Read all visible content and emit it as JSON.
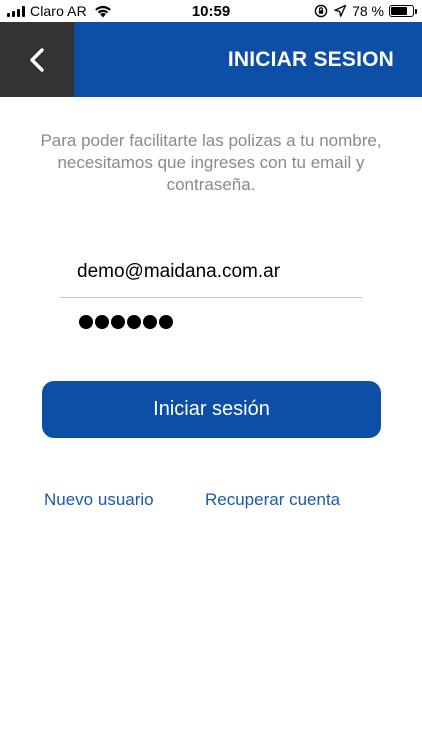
{
  "status_bar": {
    "carrier": "Claro AR",
    "time": "10:59",
    "battery_percent": "78 %",
    "battery_level": 0.78,
    "icons": [
      "signal-icon",
      "wifi-icon",
      "orientation-lock-icon",
      "location-arrow-icon",
      "battery-icon"
    ]
  },
  "header": {
    "title": "INICIAR SESION",
    "back_icon": "chevron-left-icon",
    "colors": {
      "header_bg": "#0d4ea6",
      "back_bg": "#333333"
    }
  },
  "intro": {
    "text": "Para poder facilitarte las polizas a tu nombre, necesitamos que ingreses con tu email y contraseña."
  },
  "form": {
    "email_value": "demo@maidana.com.ar",
    "password_masked": "●●●●●●",
    "password_length": 6
  },
  "actions": {
    "login_label": "Iniciar sesión",
    "new_user_label": "Nuevo usuario",
    "recover_label": "Recuperar cuenta",
    "colors": {
      "button_bg": "#0d4ea6",
      "link": "#1a5aa8"
    }
  }
}
